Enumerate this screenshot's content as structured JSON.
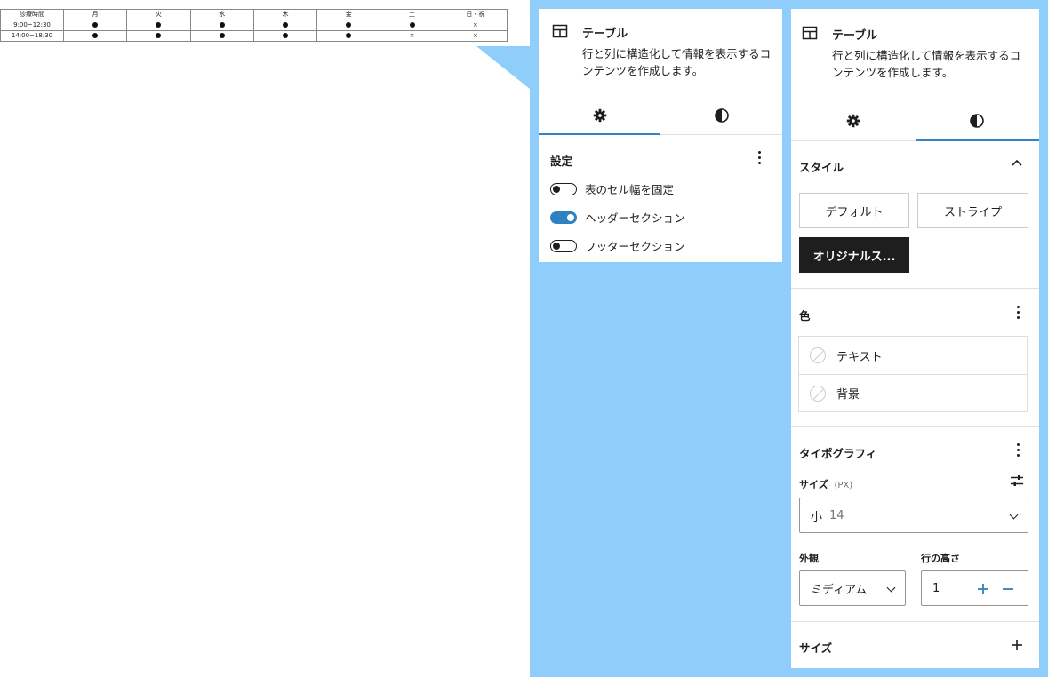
{
  "schedule": {
    "header": [
      "診療時間",
      "月",
      "火",
      "水",
      "木",
      "金",
      "土",
      "日・祝"
    ],
    "rows": [
      {
        "time": "9:00~12:30",
        "marks": [
          "●",
          "●",
          "●",
          "●",
          "●",
          "●",
          "×"
        ]
      },
      {
        "time": "14:00~18:30",
        "marks": [
          "●",
          "●",
          "●",
          "●",
          "●",
          "×",
          "×"
        ]
      }
    ]
  },
  "settings_panel": {
    "block_title": "テーブル",
    "block_description": "行と列に構造化して情報を表示するコンテンツを作成します。",
    "tabs": [
      {
        "icon": "gear-icon",
        "active": true
      },
      {
        "icon": "contrast-icon",
        "active": false
      }
    ],
    "section_label": "設定",
    "toggles": [
      {
        "label": "表のセル幅を固定",
        "on": false
      },
      {
        "label": "ヘッダーセクション",
        "on": true
      },
      {
        "label": "フッターセクション",
        "on": false
      }
    ]
  },
  "styles_panel": {
    "block_title": "テーブル",
    "block_description": "行と列に構造化して情報を表示するコンテンツを作成します。",
    "tabs": [
      {
        "icon": "gear-icon",
        "active": false
      },
      {
        "icon": "contrast-icon",
        "active": true
      }
    ],
    "style_section": {
      "label": "スタイル",
      "options": [
        {
          "label": "デフォルト",
          "selected": false
        },
        {
          "label": "ストライプ",
          "selected": false
        },
        {
          "label": "オリジナルス...",
          "selected": true
        }
      ]
    },
    "color_section": {
      "label": "色",
      "items": [
        "テキスト",
        "背景"
      ]
    },
    "typography_section": {
      "label": "タイポグラフィ",
      "size_label": "サイズ",
      "size_unit": "(PX)",
      "size_select": {
        "label": "小",
        "value": "14"
      },
      "appearance_label": "外観",
      "appearance_value": "ミディアム",
      "line_height_label": "行の高さ",
      "line_height_value": "1"
    },
    "dimensions_section": {
      "label": "サイズ"
    }
  },
  "colors": {
    "accent": "#3582c4",
    "toggle_on": "#2f82c2",
    "backdrop": "#8fcdfb",
    "selected_button": "#1e1e1e"
  }
}
